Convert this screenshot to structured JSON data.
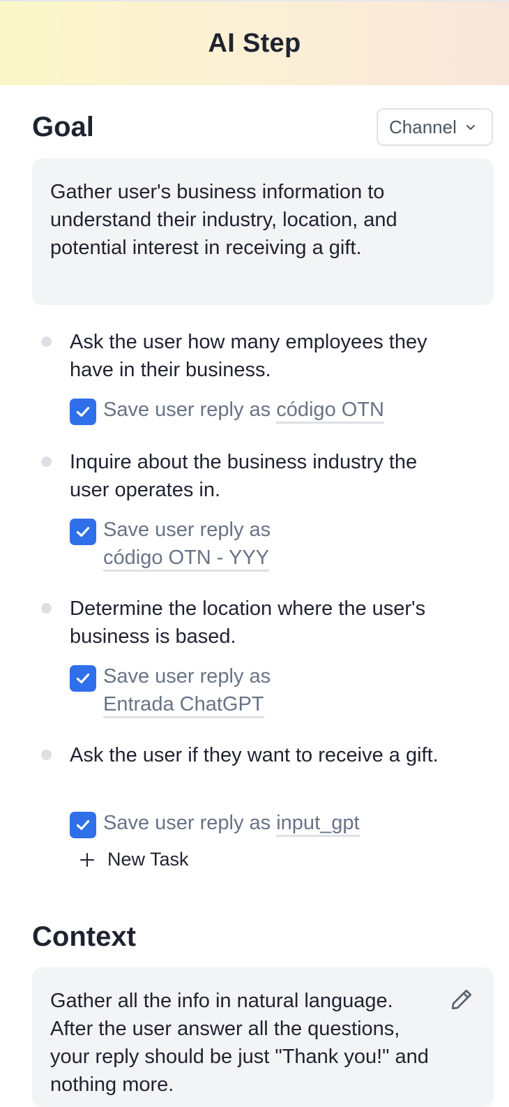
{
  "header": {
    "title": "AI Step"
  },
  "goal": {
    "title": "Goal",
    "channel_label": "Channel",
    "text": "Gather user's business information to understand their industry, location, and potential interest in receiving a gift."
  },
  "tasks": [
    {
      "text": "Ask the user how many employees they have in their business.",
      "save_prefix": "Save user reply as",
      "variable": "código OTN",
      "checked": true
    },
    {
      "text": "Inquire about the business industry the user operates in.",
      "save_prefix": "Save user reply as",
      "variable": "código OTN - YYY",
      "checked": true
    },
    {
      "text": "Determine the location where the user's business is based.",
      "save_prefix": "Save user reply as",
      "variable": "Entrada ChatGPT",
      "checked": true
    },
    {
      "text": "Ask the user if they want to receive a gift.",
      "save_prefix": "Save user reply as",
      "variable": "input_gpt",
      "checked": true
    }
  ],
  "new_task_label": "New Task",
  "context": {
    "title": "Context",
    "text": "Gather all the info in natural language. After the user answer all the questions, your reply should be just \"Thank you!\" and nothing more."
  },
  "colors": {
    "accent": "#2f6fe9",
    "panel_bg": "#f3f4f6",
    "muted_text": "#697386"
  },
  "icons": {
    "channel_dropdown": "chevron-down-icon",
    "checkbox": "checkmark-icon",
    "new_task": "plus-icon",
    "context_edit": "pencil-icon"
  }
}
